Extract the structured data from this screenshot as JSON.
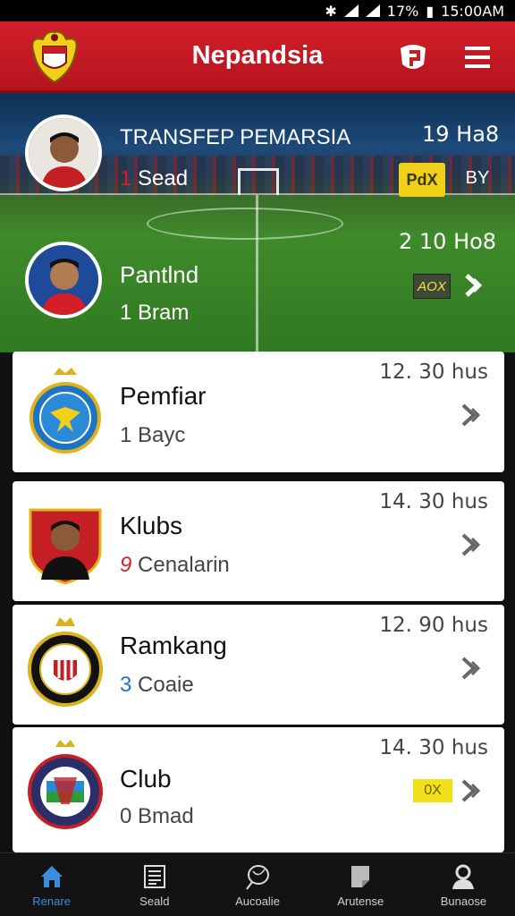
{
  "status_bar": {
    "icons": [
      "bluetooth-icon",
      "signal-icon",
      "signal-icon"
    ],
    "battery": "17%",
    "time": "15:00AM"
  },
  "header": {
    "title": "Nepandsia",
    "logo": "crest-logo",
    "icons": [
      "shield-flag-icon",
      "menu-icon"
    ]
  },
  "hero": {
    "items": [
      {
        "title": "TRANSFEP PEMARSIA",
        "sub_num": "1",
        "sub_text": "Sead",
        "time": "19 Ha8",
        "badge": "PdX",
        "badge2": "BY"
      },
      {
        "title": "Pantlnd",
        "sub_num": "1",
        "sub_text": "Bram",
        "time": "2 10 Ho8",
        "badge": "AOX"
      }
    ]
  },
  "cards": [
    {
      "name": "Pemfiar",
      "sub_num": "1",
      "sub_text": "Bayc",
      "time": "12. 30 hus",
      "colors": {
        "crest": "#1e74c4",
        "accent": "#f2cf19"
      }
    },
    {
      "name": "Klubs",
      "sub_num": "9",
      "sub_text": "Cenalarin",
      "time": "14. 30 hus",
      "colors": {
        "crest": "#c41f24",
        "accent": "#f2cf19"
      }
    },
    {
      "name": "Ramkang",
      "sub_num": "3",
      "sub_text": "Coaie",
      "time": "12. 90 hus",
      "colors": {
        "crest": "#111111",
        "accent": "#d8b21c"
      }
    },
    {
      "name": "Club",
      "sub_num": "0",
      "sub_text": "Bmad",
      "time": "14. 30 hus",
      "tag": "0X",
      "colors": {
        "crest": "#2a2f6a",
        "accent": "#c41f24"
      }
    }
  ],
  "bottom_nav": [
    {
      "label": "Renare",
      "icon": "home-icon",
      "active": true
    },
    {
      "label": "Seald",
      "icon": "news-icon"
    },
    {
      "label": "Aucoalie",
      "icon": "ball-icon"
    },
    {
      "label": "Arutense",
      "icon": "document-icon"
    },
    {
      "label": "Bunaose",
      "icon": "profile-icon"
    }
  ],
  "colors": {
    "header_red": "#d21f2a",
    "active_blue": "#3a8ee0",
    "badge_yellow": "#f2cf19"
  }
}
